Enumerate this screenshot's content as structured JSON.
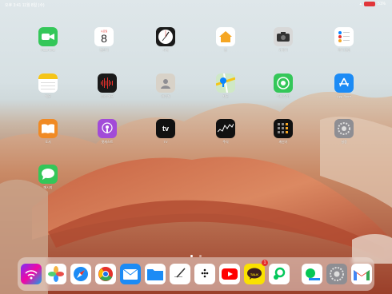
{
  "status": {
    "time": "오후 3:41",
    "date": "11월 8일 (수)",
    "battery": "51%"
  },
  "home_apps": [
    {
      "name": "FaceTime"
    },
    {
      "name": "캘린더",
      "day": "8",
      "weekday": "수요일"
    },
    {
      "name": "시계"
    },
    {
      "name": "홈"
    },
    {
      "name": "카메라"
    },
    {
      "name": "미리 알림"
    },
    {
      "name": "메모"
    },
    {
      "name": "음성 메모"
    },
    {
      "name": "연락처"
    },
    {
      "name": "지도"
    },
    {
      "name": "나의 찾기"
    },
    {
      "name": "App Store"
    },
    {
      "name": "도서"
    },
    {
      "name": "팟캐스트"
    },
    {
      "name": "TV"
    },
    {
      "name": "주식"
    },
    {
      "name": "계산기"
    },
    {
      "name": "설정"
    },
    {
      "name": "메시지"
    }
  ],
  "tv_text": "tv",
  "dock_apps": [
    "Bluetooth",
    "사진",
    "Safari",
    "Chrome",
    "Mail",
    "파일",
    "메모",
    "Tomato",
    "YouTube",
    "카카오톡",
    "Naver",
    "LINE",
    "설정",
    "Gmail"
  ],
  "kakao_text": "TALK",
  "kakao_badge": "1",
  "colors": {
    "battery": "#e1363a",
    "accent": "#ffffff"
  }
}
